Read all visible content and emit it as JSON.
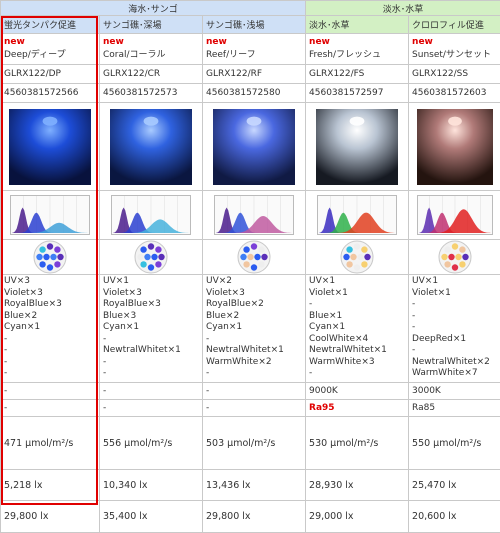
{
  "groups": [
    {
      "label": "海水･サンゴ",
      "span": 3,
      "color": "#cfe0f6"
    },
    {
      "label": "淡水･水草",
      "span": 2,
      "color": "#d3f0c4"
    }
  ],
  "products": [
    {
      "category": "蛍光タンパク促進",
      "new_label": "new",
      "name": "Deep/ディープ",
      "model": "GLRX122/DP",
      "jan": "4560381572566",
      "photo_core": "#7fb0ff",
      "photo_mid": "#1d4dd8",
      "photo_edge": "#08123d",
      "spectrum_colors": [
        "#4a1c8c",
        "#2a3fd0",
        "#3fa0d8"
      ],
      "led_colors": [
        "#5a2fb8",
        "#7b3fd8",
        "#2b5cf0",
        "#2b5cf0",
        "#3f7ef5",
        "#35c0e0",
        "#5a2fb8",
        "#7b3fd8",
        "#2b5cf0",
        "#3f7ef5"
      ],
      "leds": [
        "UV×3",
        "Violet×3",
        "RoyalBlue×3",
        "Blue×2",
        "Cyan×1",
        "-",
        "-",
        "-",
        "-"
      ],
      "color_temp": "-",
      "ra": "-",
      "ra_highlight": false,
      "par": "471 μmol/m²/s",
      "lux_a": "5,218 lx",
      "lux_b": "29,800 lx"
    },
    {
      "category": "サンゴ礁･深場",
      "new_label": "new",
      "name": "Coral/コーラル",
      "model": "GLRX122/CR",
      "jan": "4560381572573",
      "photo_core": "#a9cbff",
      "photo_mid": "#2f62e0",
      "photo_edge": "#0a1640",
      "spectrum_colors": [
        "#4a1c8c",
        "#2a3fd0",
        "#46b2dc"
      ],
      "led_colors": [
        "#5a2fb8",
        "#7b3fd8",
        "#2b5cf0",
        "#35c0e0",
        "#eeeeee",
        "#2b5cf0",
        "#5a2fb8",
        "#7b3fd8",
        "#3f7ef5",
        "#2b5cf0"
      ],
      "leds": [
        "UV×1",
        "Violet×3",
        "RoyalBlue×3",
        "Blue×3",
        "Cyan×1",
        "-",
        "NewtralWhitet×1",
        "-",
        "-"
      ],
      "color_temp": "-",
      "ra": "-",
      "ra_highlight": false,
      "par": "556 μmol/m²/s",
      "lux_a": "10,340 lx",
      "lux_b": "35,400 lx"
    },
    {
      "category": "サンゴ礁･浅場",
      "new_label": "new",
      "name": "Reef/リーフ",
      "model": "GLRX122/RF",
      "jan": "4560381572580",
      "photo_core": "#c8d8ff",
      "photo_mid": "#4a68e0",
      "photo_edge": "#101a44",
      "spectrum_colors": [
        "#4a1c8c",
        "#3052d8",
        "#c05aa0"
      ],
      "led_colors": [
        "#5a2fb8",
        "#eeeeee",
        "#2b5cf0",
        "#f1c6a0",
        "#3f7ef5",
        "#2b5cf0",
        "#7b3fd8",
        "#eeeeee",
        "#f1c6a0",
        "#2b5cf0"
      ],
      "leds": [
        "UV×2",
        "Violet×3",
        "RoyalBlue×2",
        "Blue×2",
        "Cyan×1",
        "-",
        "NewtralWhitet×1",
        "WarmWhite×2",
        "-"
      ],
      "color_temp": "-",
      "ra": "-",
      "ra_highlight": false,
      "par": "503 μmol/m²/s",
      "lux_a": "13,436 lx",
      "lux_b": "29,800 lx"
    },
    {
      "category": "淡水･水草",
      "new_label": "new",
      "name": "Fresh/フレッシュ",
      "model": "GLRX122/FS",
      "jan": "4560381572597",
      "photo_core": "#ffffff",
      "photo_mid": "#b9c4d2",
      "photo_edge": "#161a22",
      "spectrum_colors": [
        "#3a2cc0",
        "#2fb04a",
        "#e04020"
      ],
      "led_colors": [
        "#5a2fb8",
        "#f7d070",
        "#eeeeee",
        "#f1c6a0",
        "#2b5cf0",
        "#35c0e0",
        "#eeeeee",
        "#f7d070",
        "#f1c6a0",
        "#eeeeee"
      ],
      "leds": [
        "UV×1",
        "Violet×1",
        "-",
        "Blue×1",
        "Cyan×1",
        "CoolWhite×4",
        "NewtralWhitet×1",
        "WarmWhite×3",
        "-"
      ],
      "color_temp": "9000K",
      "ra": "Ra95",
      "ra_highlight": true,
      "par": "530 μmol/m²/s",
      "lux_a": "28,930 lx",
      "lux_b": "29,000 lx"
    },
    {
      "category": "クロロフィル促進",
      "new_label": "new",
      "name": "Sunset/サンセット",
      "model": "GLRX122/SS",
      "jan": "4560381572603",
      "photo_core": "#ffe4dc",
      "photo_mid": "#b07a78",
      "photo_edge": "#24140f",
      "spectrum_colors": [
        "#5a2cb0",
        "#c03070",
        "#e02020"
      ],
      "led_colors": [
        "#5a2fb8",
        "#f7d070",
        "#e0304a",
        "#f1c6a0",
        "#f7d070",
        "#eeeeee",
        "#f7d070",
        "#f1c6a0",
        "#e0304a",
        "#f7d070"
      ],
      "leds": [
        "UV×1",
        "Violet×1",
        "-",
        "-",
        "-",
        "DeepRed×1",
        "-",
        "NewtralWhitet×2",
        "WarmWhite×7"
      ],
      "color_temp": "3000K",
      "ra": "Ra85",
      "ra_highlight": false,
      "par": "550 μmol/m²/s",
      "lux_a": "25,470 lx",
      "lux_b": "20,600 lx"
    }
  ]
}
